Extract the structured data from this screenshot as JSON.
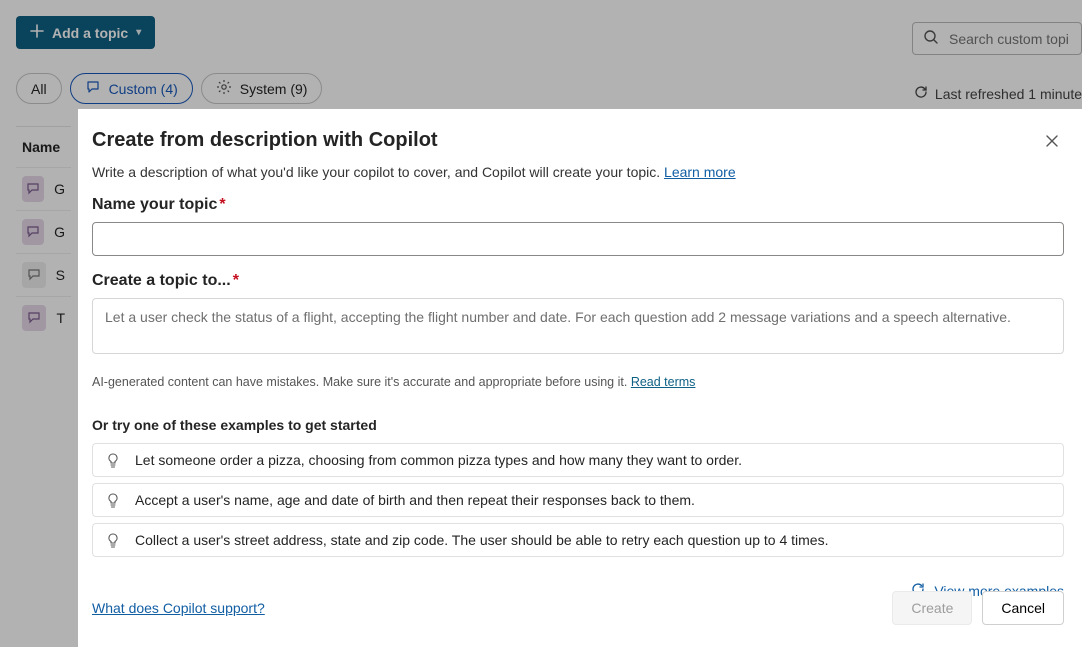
{
  "header": {
    "add_button": "Add a topic",
    "search_placeholder": "Search custom topics",
    "refresh_text": "Last refreshed 1 minute"
  },
  "tabs": {
    "all": "All",
    "custom": "Custom (4)",
    "system": "System (9)"
  },
  "table": {
    "col_name": "Name",
    "rows": [
      "G",
      "G",
      "S",
      "T"
    ]
  },
  "dialog": {
    "title": "Create from description with Copilot",
    "subtitle_pre": "Write a description of what you'd like your copilot to cover, and Copilot will create your topic. ",
    "learn_more": "Learn more",
    "field_name_label": "Name your topic",
    "field_desc_label": "Create a topic to...",
    "desc_placeholder": "Let a user check the status of a flight, accepting the flight number and date. For each question add 2 message variations and a speech alternative.",
    "disclaimer_pre": "AI-generated content can have mistakes. Make sure it's accurate and appropriate before using it. ",
    "disclaimer_link": "Read terms",
    "examples_title": "Or try one of these examples to get started",
    "examples": [
      "Let someone order a pizza, choosing from common pizza types and how many they want to order.",
      "Accept a user's name, age and date of birth and then repeat their responses back to them.",
      "Collect a user's street address, state and zip code. The user should be able to retry each question up to 4 times."
    ],
    "view_more": "View more examples",
    "support_link": "What does Copilot support?",
    "create_btn": "Create",
    "cancel_btn": "Cancel"
  }
}
